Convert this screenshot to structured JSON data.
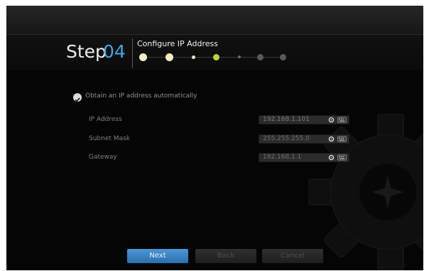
{
  "wizard": {
    "step_label": "Step",
    "step_number": "04",
    "step_title": "Configure IP Address",
    "progress": {
      "total_steps": 7,
      "current_step": 4
    }
  },
  "form": {
    "auto_ip_option": "Obtain an IP address automatically",
    "auto_ip_checked": true,
    "fields": [
      {
        "label": "IP Address",
        "value": "192.168.1.101"
      },
      {
        "label": "Subnet Mask",
        "value": "255.255.255.0"
      },
      {
        "label": "Gateway",
        "value": "192.168.1.1"
      }
    ]
  },
  "buttons": {
    "next": "Next",
    "back": "Back",
    "cancel": "Cancel"
  },
  "colors": {
    "accent": "#3fa7e6",
    "progress_done": "#f3eec2",
    "progress_current": "#b7d63a",
    "progress_pending": "#5a5a5a"
  }
}
